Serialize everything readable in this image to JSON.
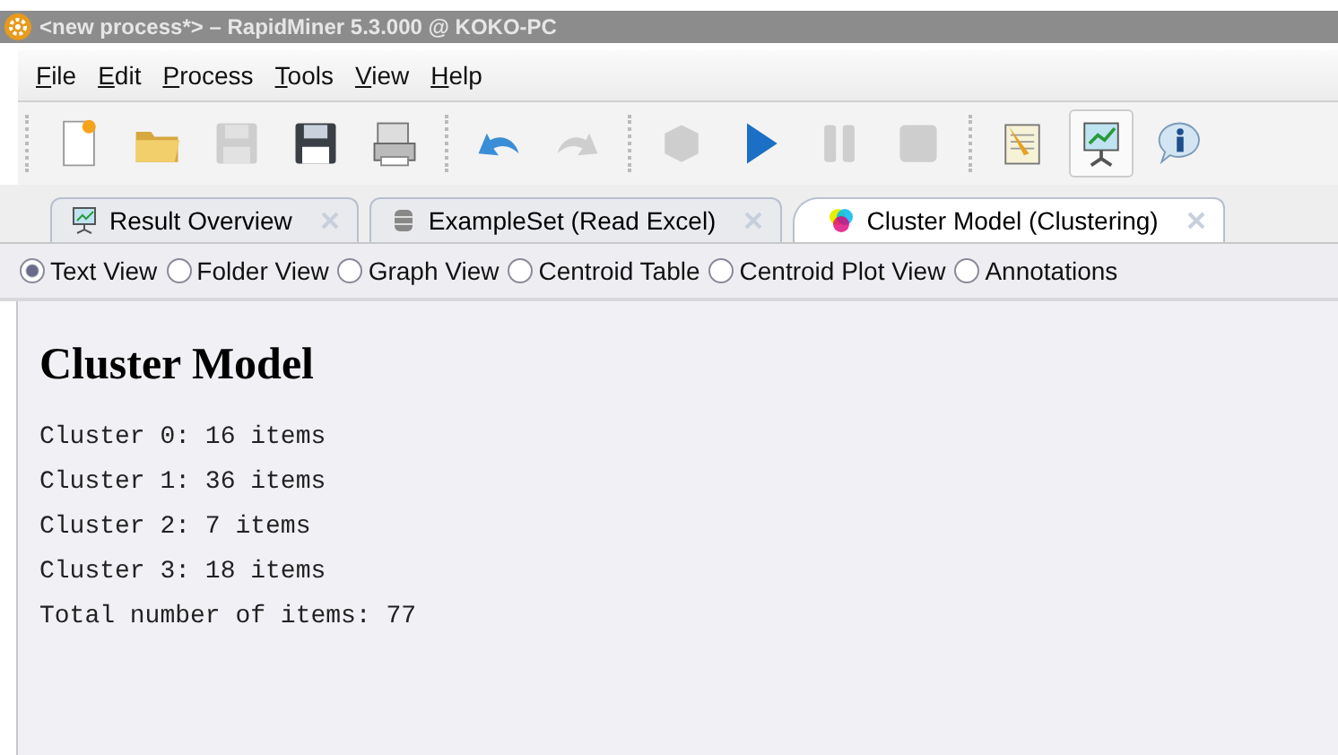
{
  "window": {
    "title": "<new process*> – RapidMiner 5.3.000 @ KOKO-PC"
  },
  "menu": [
    "File",
    "Edit",
    "Process",
    "Tools",
    "View",
    "Help"
  ],
  "toolbar": [
    [
      {
        "kind": "new",
        "disabled": false
      },
      {
        "kind": "open",
        "disabled": false
      },
      {
        "kind": "save",
        "disabled": true
      },
      {
        "kind": "save-as",
        "disabled": false
      },
      {
        "kind": "print",
        "disabled": false
      }
    ],
    [
      {
        "kind": "undo",
        "disabled": false
      },
      {
        "kind": "redo",
        "disabled": true
      }
    ],
    [
      {
        "kind": "cube",
        "disabled": true
      },
      {
        "kind": "run",
        "disabled": false
      },
      {
        "kind": "pause",
        "disabled": true
      },
      {
        "kind": "stop",
        "disabled": true
      }
    ],
    [
      {
        "kind": "notes",
        "disabled": false,
        "selected": false
      },
      {
        "kind": "results",
        "disabled": false,
        "selected": true
      },
      {
        "kind": "info",
        "disabled": false,
        "selected": false
      }
    ]
  ],
  "tabs": [
    {
      "label": "Result Overview",
      "kind": "chart",
      "selected": false
    },
    {
      "label": "ExampleSet (Read Excel)",
      "kind": "database",
      "selected": false
    },
    {
      "label": "Cluster Model (Clustering)",
      "kind": "colors",
      "selected": true
    }
  ],
  "views": [
    {
      "label": "Text View",
      "selected": true
    },
    {
      "label": "Folder View",
      "selected": false
    },
    {
      "label": "Graph View",
      "selected": false
    },
    {
      "label": "Centroid Table",
      "selected": false
    },
    {
      "label": "Centroid Plot View",
      "selected": false
    },
    {
      "label": "Annotations",
      "selected": false
    }
  ],
  "content": {
    "heading": "Cluster Model",
    "lines": [
      "Cluster 0: 16 items",
      "Cluster 1: 36 items",
      "Cluster 2: 7 items",
      "Cluster 3: 18 items",
      "Total number of items: 77"
    ]
  }
}
